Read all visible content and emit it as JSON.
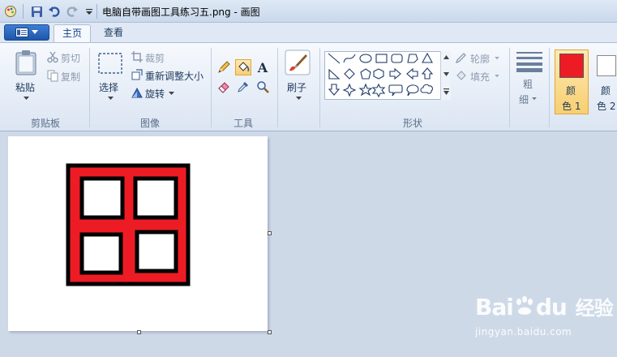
{
  "titlebar": {
    "title": "电脑自带画图工具练习五.png - 画图"
  },
  "tabs": {
    "home": "主页",
    "view": "查看"
  },
  "clipboard": {
    "paste": "粘贴",
    "cut": "剪切",
    "copy": "复制",
    "group_label": "剪贴板"
  },
  "image": {
    "select": "选择",
    "crop": "裁剪",
    "resize": "重新调整大小",
    "rotate": "旋转",
    "group_label": "图像"
  },
  "tools": {
    "group_label": "工具",
    "text_glyph": "A"
  },
  "brushes": {
    "label": "刷子"
  },
  "shapes": {
    "outline": "轮廓",
    "fill": "填充",
    "group_label": "形状"
  },
  "size": {
    "label_1": "粗",
    "label_2": "细"
  },
  "colors": {
    "color1_line1": "颜",
    "color1_line2": "色 1",
    "color2_line1": "颜",
    "color2_line2": "色 2",
    "color1_value": "#ed1c24",
    "color2_value": "#ffffff"
  },
  "watermark": {
    "brand_text": "Bai",
    "brand_text2": "du",
    "cn_text": "经验",
    "url": "jingyan.baidu.com"
  }
}
